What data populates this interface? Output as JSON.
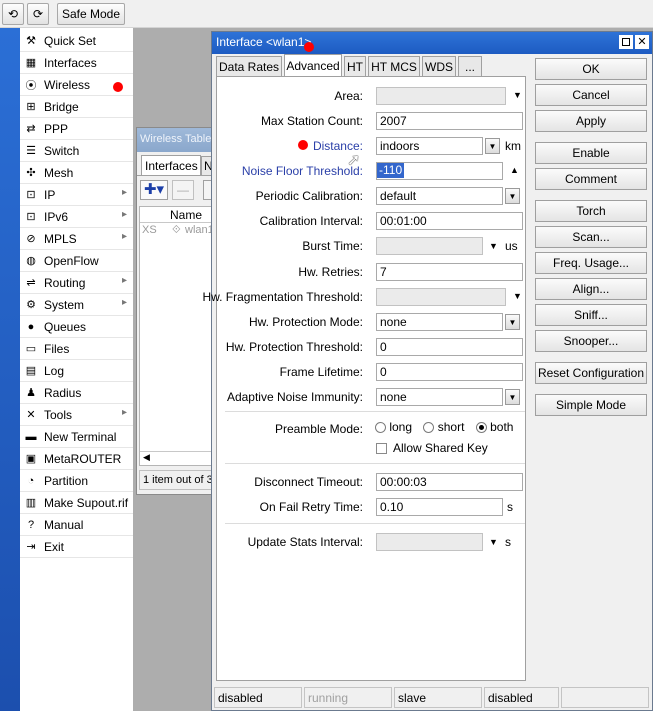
{
  "toolbar": {
    "undo_icon": "undo-icon",
    "redo_icon": "redo-icon",
    "safe_mode": "Safe Mode"
  },
  "sidebar": {
    "items": [
      {
        "label": "Quick Set",
        "icon": "quick-set-icon",
        "glyph": "⚒"
      },
      {
        "label": "Interfaces",
        "icon": "interfaces-icon",
        "glyph": "▦"
      },
      {
        "label": "Wireless",
        "icon": "wireless-icon",
        "glyph": "⦿"
      },
      {
        "label": "Bridge",
        "icon": "bridge-icon",
        "glyph": "⊞"
      },
      {
        "label": "PPP",
        "icon": "ppp-icon",
        "glyph": "⇄"
      },
      {
        "label": "Switch",
        "icon": "switch-icon",
        "glyph": "☰"
      },
      {
        "label": "Mesh",
        "icon": "mesh-icon",
        "glyph": "✣"
      },
      {
        "label": "IP",
        "icon": "ip-icon",
        "glyph": "⊡",
        "submenu": true
      },
      {
        "label": "IPv6",
        "icon": "ipv6-icon",
        "glyph": "⊡",
        "submenu": true
      },
      {
        "label": "MPLS",
        "icon": "mpls-icon",
        "glyph": "⊘",
        "submenu": true
      },
      {
        "label": "OpenFlow",
        "icon": "openflow-icon",
        "glyph": "◍"
      },
      {
        "label": "Routing",
        "icon": "routing-icon",
        "glyph": "⇌",
        "submenu": true
      },
      {
        "label": "System",
        "icon": "system-icon",
        "glyph": "⚙",
        "submenu": true
      },
      {
        "label": "Queues",
        "icon": "queues-icon",
        "glyph": "●"
      },
      {
        "label": "Files",
        "icon": "files-icon",
        "glyph": "▭"
      },
      {
        "label": "Log",
        "icon": "log-icon",
        "glyph": "▤"
      },
      {
        "label": "Radius",
        "icon": "radius-icon",
        "glyph": "♟"
      },
      {
        "label": "Tools",
        "icon": "tools-icon",
        "glyph": "✕",
        "submenu": true
      },
      {
        "label": "New Terminal",
        "icon": "terminal-icon",
        "glyph": "▬"
      },
      {
        "label": "MetaROUTER",
        "icon": "metarouter-icon",
        "glyph": "▣"
      },
      {
        "label": "Partition",
        "icon": "partition-icon",
        "glyph": "◔"
      },
      {
        "label": "Make Supout.rif",
        "icon": "supout-icon",
        "glyph": "▥"
      },
      {
        "label": "Manual",
        "icon": "manual-icon",
        "glyph": "?"
      },
      {
        "label": "Exit",
        "icon": "exit-icon",
        "glyph": "⇥"
      }
    ]
  },
  "bg_window": {
    "title": "Wireless Tables",
    "tab_interfaces": "Interfaces",
    "tab_next": "N",
    "col_name": "Name",
    "row_flag": "XS",
    "row_name": "wlan1",
    "footer": "1 item out of 3"
  },
  "dialog": {
    "title": "Interface <wlan1>",
    "tabs": [
      "Data Rates",
      "Advanced",
      "HT",
      "HT MCS",
      "WDS",
      "..."
    ],
    "fields": {
      "area": {
        "label": "Area:",
        "value": ""
      },
      "max_station_count": {
        "label": "Max Station Count:",
        "value": "2007"
      },
      "distance": {
        "label": "Distance:",
        "value": "indoors",
        "unit": "km"
      },
      "noise_floor": {
        "label": "Noise Floor Threshold:",
        "value": "-110"
      },
      "periodic_calibration": {
        "label": "Periodic Calibration:",
        "value": "default"
      },
      "calibration_interval": {
        "label": "Calibration Interval:",
        "value": "00:01:00"
      },
      "burst_time": {
        "label": "Burst Time:",
        "value": "",
        "unit": "us"
      },
      "hw_retries": {
        "label": "Hw. Retries:",
        "value": "7"
      },
      "hw_frag": {
        "label": "Hw. Fragmentation Threshold:",
        "value": ""
      },
      "hw_prot_mode": {
        "label": "Hw. Protection Mode:",
        "value": "none"
      },
      "hw_prot_threshold": {
        "label": "Hw. Protection Threshold:",
        "value": "0"
      },
      "frame_lifetime": {
        "label": "Frame Lifetime:",
        "value": "0"
      },
      "adaptive_noise": {
        "label": "Adaptive Noise Immunity:",
        "value": "none"
      },
      "preamble": {
        "label": "Preamble Mode:",
        "options": [
          "long",
          "short",
          "both"
        ],
        "selected": "both"
      },
      "allow_shared_key": {
        "label": "Allow Shared Key",
        "checked": false
      },
      "disconnect_timeout": {
        "label": "Disconnect Timeout:",
        "value": "00:00:03"
      },
      "on_fail_retry": {
        "label": "On Fail Retry Time:",
        "value": "0.10",
        "unit": "s"
      },
      "update_stats": {
        "label": "Update Stats Interval:",
        "value": "",
        "unit": "s"
      }
    },
    "buttons": [
      "OK",
      "Cancel",
      "Apply",
      "Enable",
      "Comment",
      "Torch",
      "Scan...",
      "Freq. Usage...",
      "Align...",
      "Sniff...",
      "Snooper...",
      "Reset Configuration",
      "Simple Mode"
    ],
    "status": [
      "disabled",
      "running",
      "slave",
      "disabled",
      ""
    ]
  },
  "colors": {
    "accent": "#1d5bc2",
    "marker": "#ff0000",
    "link_label": "#2a3fa8"
  }
}
